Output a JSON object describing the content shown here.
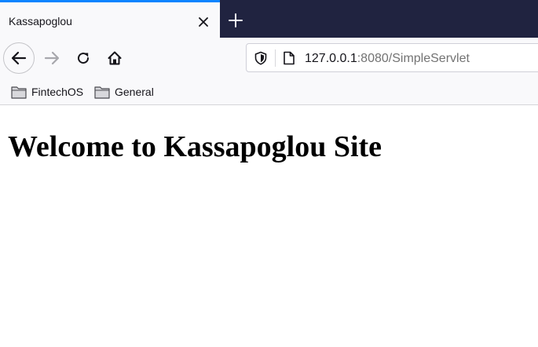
{
  "tab": {
    "title": "Kassapoglou"
  },
  "navigation": {
    "url_host": "127.0.0.1",
    "url_rest": ":8080/SimpleServlet"
  },
  "bookmarks": [
    {
      "label": "FintechOS",
      "icon": "folder-icon"
    },
    {
      "label": "General",
      "icon": "folder-icon"
    }
  ],
  "page": {
    "heading": "Welcome to Kassapoglou Site"
  },
  "colors": {
    "tabstrip_bg": "#202340",
    "tab_accent": "#0a84ff",
    "toolbar_bg": "#f9f9fb"
  }
}
